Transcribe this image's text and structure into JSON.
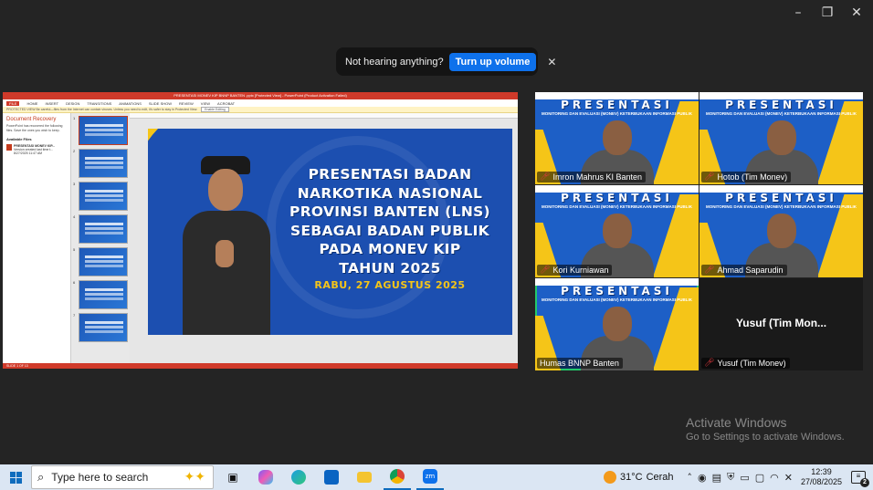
{
  "window": {
    "minimize_icon": "–",
    "restore_icon": "❐",
    "close_icon": "✕"
  },
  "toast": {
    "message": "Not hearing anything?",
    "button": "Turn up volume",
    "close": "✕"
  },
  "powerpoint": {
    "title_bar": "PRESENTASI MONEV KIP BNNP BANTEN .pptx [Protected View] - PowerPoint (Product Activation Failed)",
    "ribbon_tabs": [
      "FILE",
      "HOME",
      "INSERT",
      "DESIGN",
      "TRANSITIONS",
      "ANIMATIONS",
      "SLIDE SHOW",
      "REVIEW",
      "VIEW",
      "ACROBAT"
    ],
    "protected_view": "PROTECTED VIEW  Be careful—files from the Internet can contain viruses. Unless you need to edit, it's safer to stay in Protected View.",
    "enable_editing": "Enable Editing",
    "recovery_title": "Document Recovery",
    "recovery_desc": "PowerPoint has recovered the following files. Save the ones you wish to keep.",
    "available_files": "Available Files",
    "recovered_file": "PRESENTASI MONEV KIP...",
    "recovered_file_sub": "Version created last time t...",
    "recovered_file_date": "8/27/2025 11:47 AM",
    "thumb_numbers": [
      "1",
      "2",
      "3",
      "4",
      "5",
      "6",
      "7"
    ],
    "status": "SLIDE 1 OF 13",
    "slide_lines": [
      "PRESENTASI BADAN",
      "NARKOTIKA NASIONAL",
      "PROVINSI BANTEN (LNS)",
      "SEBAGAI BADAN PUBLIK",
      "PADA MONEV KIP",
      "TAHUN 2025"
    ],
    "slide_date": "RABU, 27 AGUSTUS 2025"
  },
  "participants": [
    {
      "name": "Imron Mahrus KI Banten",
      "muted": true,
      "has_video": true,
      "active": false
    },
    {
      "name": "Hotob (Tim Monev)",
      "muted": true,
      "has_video": true,
      "active": false
    },
    {
      "name": "Kori Kurniawan",
      "muted": true,
      "has_video": true,
      "active": false
    },
    {
      "name": "Ahmad Saparudin",
      "muted": true,
      "has_video": true,
      "active": false
    },
    {
      "name": "Humas BNNP Banten",
      "muted": false,
      "has_video": true,
      "active": true
    },
    {
      "name": "Yusuf (Tim Monev)",
      "muted": true,
      "has_video": false,
      "active": false,
      "display_name": "Yusuf  (Tim Mon..."
    }
  ],
  "video_bg": {
    "title": "PRESENTASI",
    "subtitle": "MONITORING DAN EVALUASI (MONEV) KETERBUKAAN INFORMASI PUBLIK"
  },
  "activate": {
    "line1": "Activate Windows",
    "line2": "Go to Settings to activate Windows."
  },
  "taskbar": {
    "search_placeholder": "Type here to search",
    "weather_temp": "31°C",
    "weather_desc": "Cerah",
    "time": "12:39",
    "date": "27/08/2025",
    "notification_count": "2"
  },
  "colors": {
    "zoom_bg": "#242424",
    "zoom_blue": "#0e71eb",
    "active_speaker": "#23c96b",
    "slide_blue": "#1c4fb0",
    "slide_yellow": "#f5c518"
  }
}
